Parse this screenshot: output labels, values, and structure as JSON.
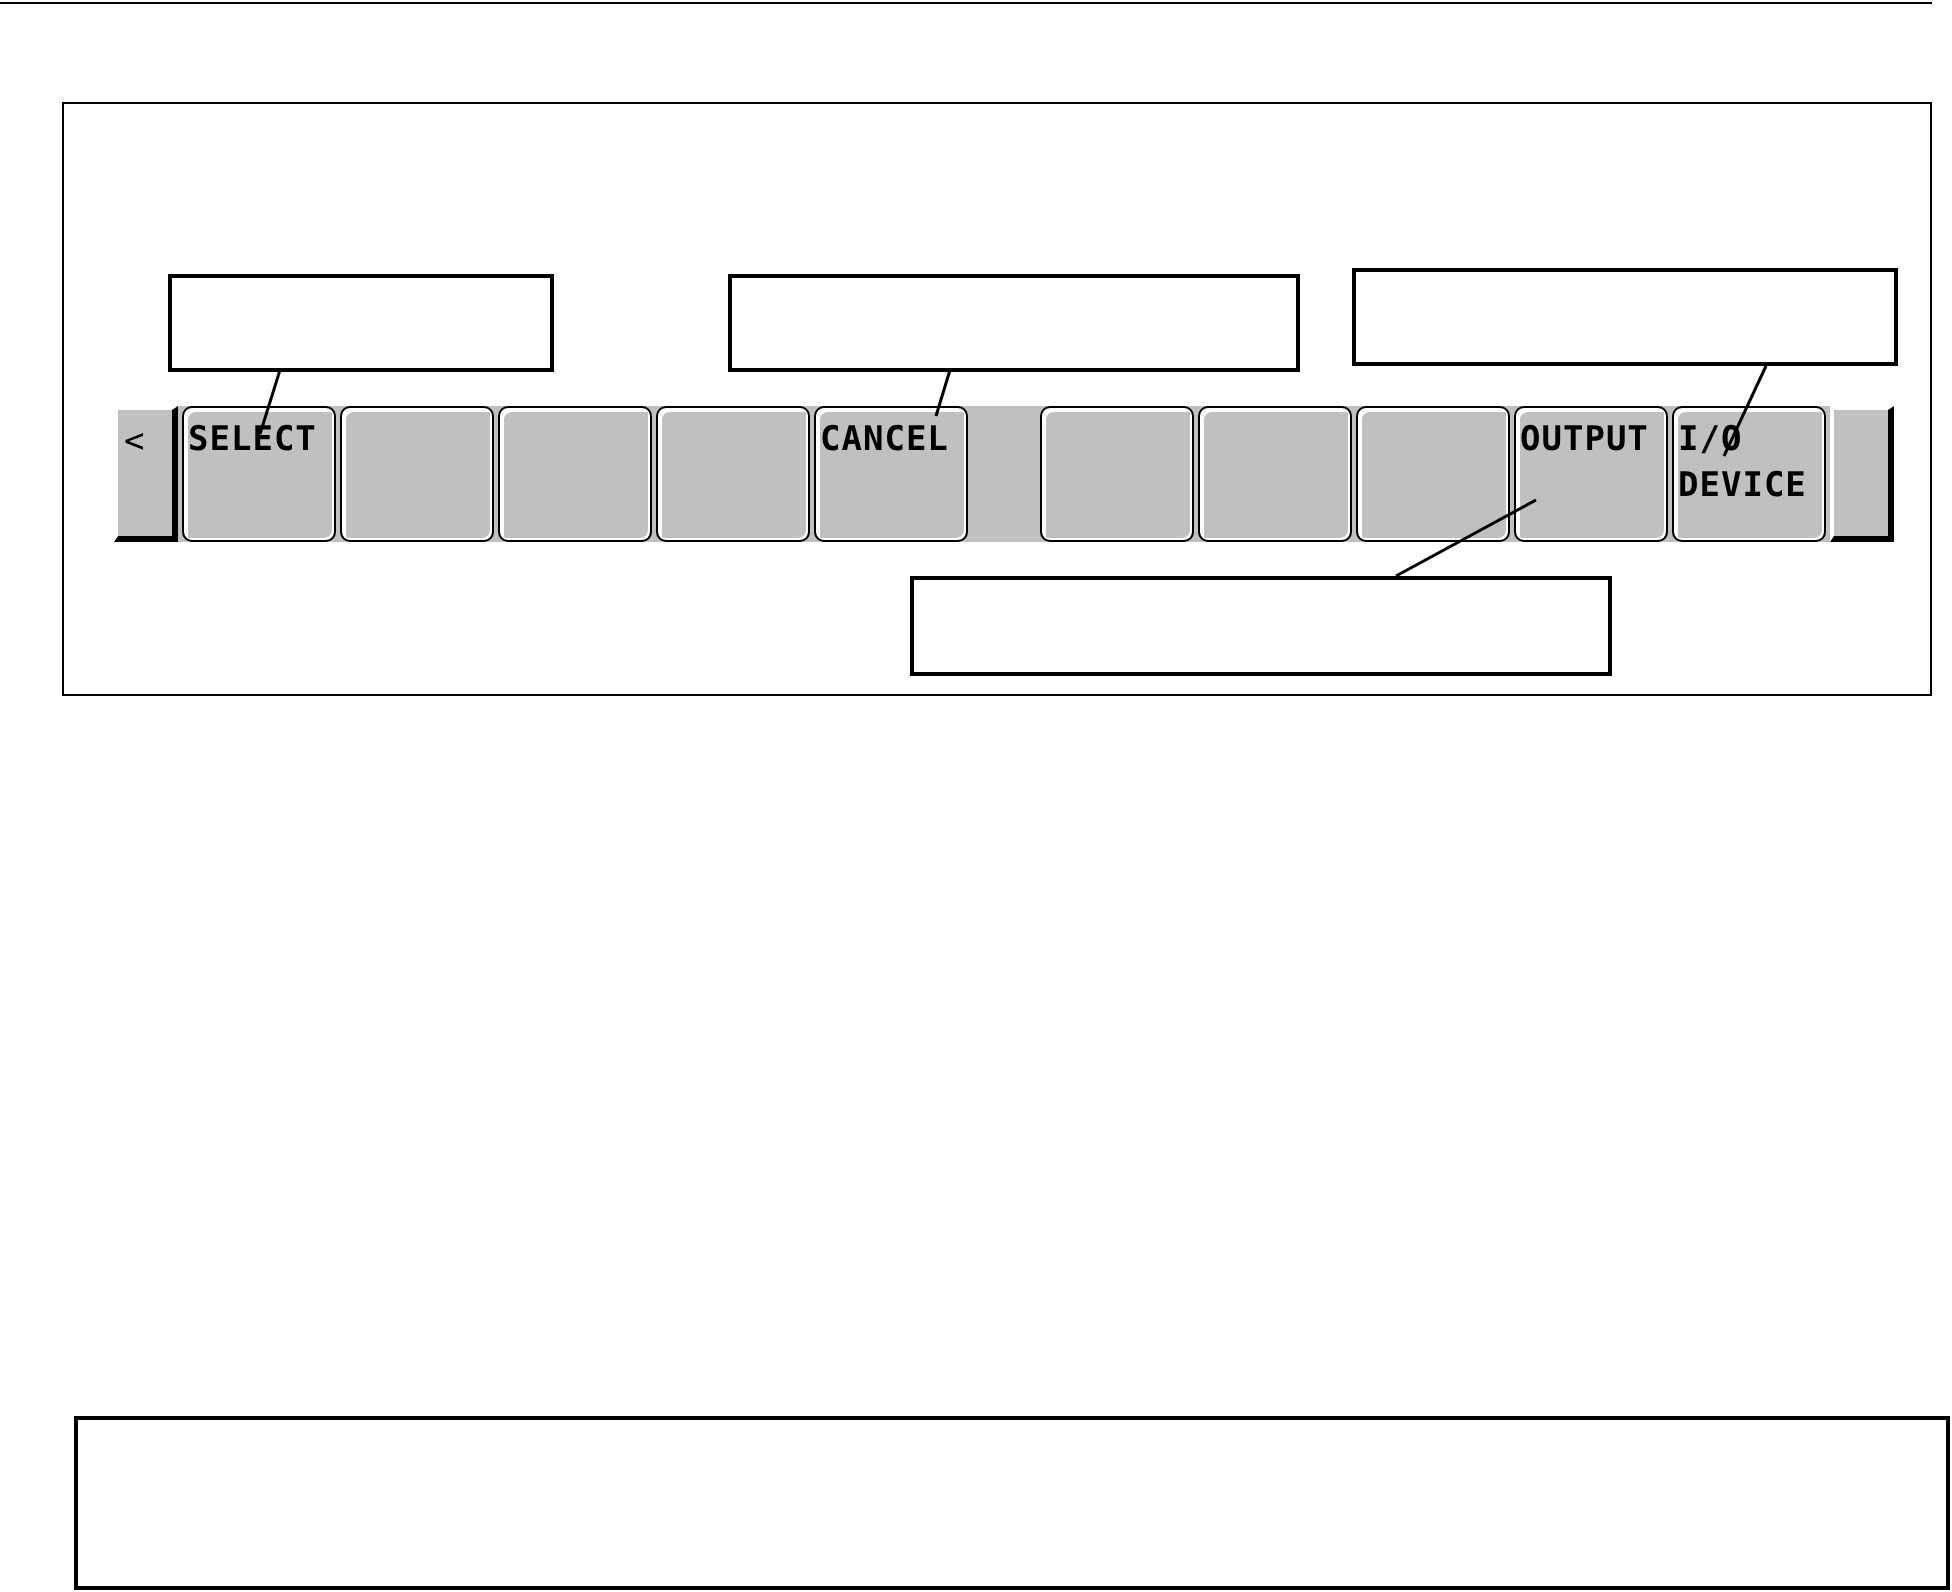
{
  "soft_key_bar": {
    "keys": [
      {
        "kind": "page",
        "label": "<"
      },
      {
        "kind": "function",
        "label": "SELECT"
      },
      {
        "kind": "function"
      },
      {
        "kind": "function"
      },
      {
        "kind": "function"
      },
      {
        "kind": "function",
        "label": "CANCEL"
      },
      {
        "kind": "gap"
      },
      {
        "kind": "function"
      },
      {
        "kind": "function"
      },
      {
        "kind": "function"
      },
      {
        "kind": "function",
        "label": "OUTPUT"
      },
      {
        "kind": "function",
        "label": "I/O DEVICE"
      },
      {
        "kind": "page"
      }
    ]
  }
}
